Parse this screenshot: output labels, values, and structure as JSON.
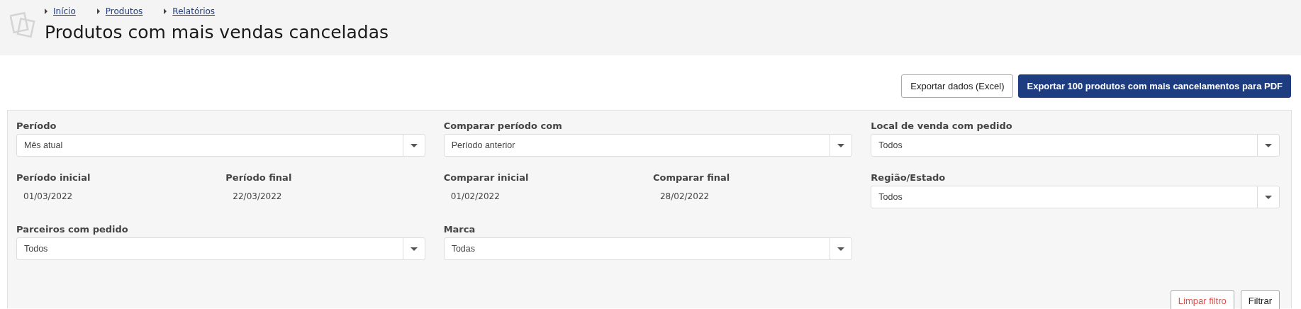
{
  "breadcrumbs": [
    "Início",
    "Produtos",
    "Relatórios"
  ],
  "title": "Produtos com mais vendas canceladas",
  "actions": [
    {
      "label": "Exportar dados (Excel)",
      "kind": "secondary"
    },
    {
      "label": "Exportar 100 produtos com mais cancelamentos para PDF",
      "kind": "primary"
    }
  ],
  "filter_columns": [
    {
      "fields": [
        {
          "kind": "select",
          "label": "Período",
          "value": "Mês atual"
        },
        {
          "kind": "dates",
          "items": [
            {
              "label": "Período inicial",
              "value": "01/03/2022"
            },
            {
              "label": "Período final",
              "value": "22/03/2022"
            }
          ]
        },
        {
          "kind": "select",
          "label": "Parceiros com pedido",
          "value": "Todos"
        }
      ]
    },
    {
      "fields": [
        {
          "kind": "select",
          "label": "Comparar período com",
          "value": "Período anterior"
        },
        {
          "kind": "dates",
          "items": [
            {
              "label": "Comparar inicial",
              "value": "01/02/2022"
            },
            {
              "label": "Comparar final",
              "value": "28/02/2022"
            }
          ]
        },
        {
          "kind": "select",
          "label": "Marca",
          "value": "Todas"
        }
      ]
    },
    {
      "fields": [
        {
          "kind": "select",
          "label": "Local de venda com pedido",
          "value": "Todos"
        },
        {
          "kind": "select",
          "label": "Região/Estado",
          "value": "Todos"
        }
      ]
    }
  ],
  "filter_buttons": [
    {
      "label": "Limpar filtro",
      "kind": "danger"
    },
    {
      "label": "Filtrar",
      "kind": "default"
    }
  ]
}
